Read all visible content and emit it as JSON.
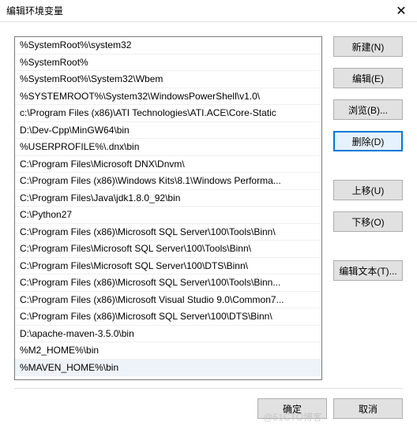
{
  "window": {
    "title": "编辑环境变量",
    "close_icon": "✕"
  },
  "list": {
    "items": [
      "%SystemRoot%\\system32",
      "%SystemRoot%",
      "%SystemRoot%\\System32\\Wbem",
      "%SYSTEMROOT%\\System32\\WindowsPowerShell\\v1.0\\",
      "c:\\Program Files (x86)\\ATI Technologies\\ATI.ACE\\Core-Static",
      "D:\\Dev-Cpp\\MinGW64\\bin",
      "%USERPROFILE%\\.dnx\\bin",
      "C:\\Program Files\\Microsoft DNX\\Dnvm\\",
      "C:\\Program Files (x86)\\Windows Kits\\8.1\\Windows Performa...",
      "C:\\Program Files\\Java\\jdk1.8.0_92\\bin",
      "C:\\Python27",
      "C:\\Program Files (x86)\\Microsoft SQL Server\\100\\Tools\\Binn\\",
      "C:\\Program Files\\Microsoft SQL Server\\100\\Tools\\Binn\\",
      "C:\\Program Files\\Microsoft SQL Server\\100\\DTS\\Binn\\",
      "C:\\Program Files (x86)\\Microsoft SQL Server\\100\\Tools\\Binn...",
      "C:\\Program Files (x86)\\Microsoft Visual Studio 9.0\\Common7...",
      "C:\\Program Files (x86)\\Microsoft SQL Server\\100\\DTS\\Binn\\",
      "D:\\apache-maven-3.5.0\\bin",
      "%M2_HOME%\\bin",
      "%MAVEN_HOME%\\bin"
    ],
    "selected_index": 19
  },
  "buttons": {
    "new": "新建(N)",
    "edit": "编辑(E)",
    "browse": "浏览(B)...",
    "delete": "删除(D)",
    "move_up": "上移(U)",
    "move_down": "下移(O)",
    "edit_text": "编辑文本(T)...",
    "ok": "确定",
    "cancel": "取消"
  },
  "watermark": "@51CTO博客"
}
